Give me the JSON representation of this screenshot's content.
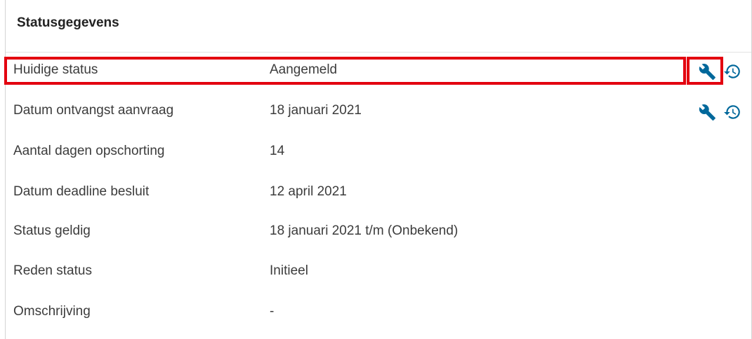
{
  "panel": {
    "title": "Statusgegevens"
  },
  "rows": [
    {
      "label": "Huidige status",
      "value": "Aangemeld",
      "has_actions": true
    },
    {
      "label": "Datum ontvangst aanvraag",
      "value": "18 januari 2021",
      "has_actions": true
    },
    {
      "label": "Aantal dagen opschorting",
      "value": "14",
      "has_actions": false
    },
    {
      "label": "Datum deadline besluit",
      "value": "12 april 2021",
      "has_actions": false
    },
    {
      "label": "Status geldig",
      "value": "18 januari 2021 t/m (Onbekend)",
      "has_actions": false
    },
    {
      "label": "Reden status",
      "value": "Initieel",
      "has_actions": false
    },
    {
      "label": "Omschrijving",
      "value": "-",
      "has_actions": false
    }
  ],
  "icons": {
    "edit": "wrench-icon",
    "history": "history-icon"
  },
  "colors": {
    "icon": "#01689b",
    "highlight": "#e3000f",
    "text": "#3c3c3c"
  }
}
